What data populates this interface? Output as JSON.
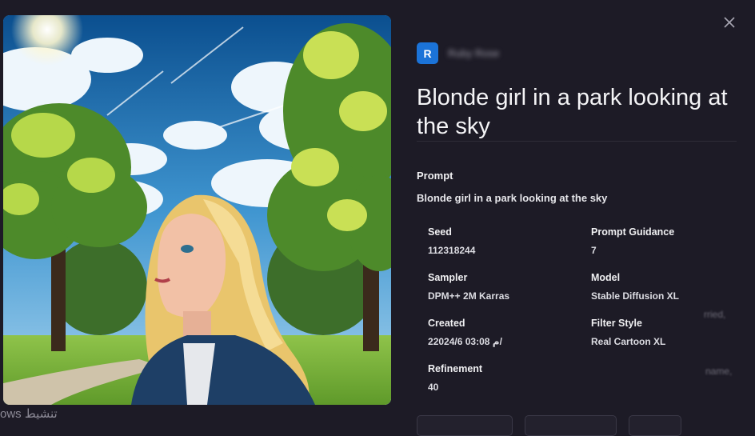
{
  "author": {
    "avatar_letter": "R",
    "name": "Ruby Rose",
    "avatar_color": "#1b73d8"
  },
  "title": "Blonde girl in a park looking at the sky",
  "prompt": {
    "label": "Prompt",
    "value": "Blonde girl in a park looking at the sky"
  },
  "details": {
    "seed": {
      "label": "Seed",
      "value": "112318244"
    },
    "prompt_guidance": {
      "label": "Prompt Guidance",
      "value": "7"
    },
    "sampler": {
      "label": "Sampler",
      "value": "DPM++ 2M Karras"
    },
    "model": {
      "label": "Model",
      "value": "Stable Diffusion XL"
    },
    "created": {
      "label": "Created",
      "value": "2م 03:08 2024/6/"
    },
    "filter_style": {
      "label": "Filter Style",
      "value": "Real Cartoon XL"
    },
    "refinement": {
      "label": "Refinement",
      "value": "40"
    }
  },
  "background_fragments": [
    "rried,",
    "name,"
  ],
  "watermark": "ows تنشيط",
  "icons": {
    "close": "close-icon"
  },
  "colors": {
    "background": "#1d1b26",
    "text": "#ffffff",
    "muted": "#9a98a4"
  }
}
